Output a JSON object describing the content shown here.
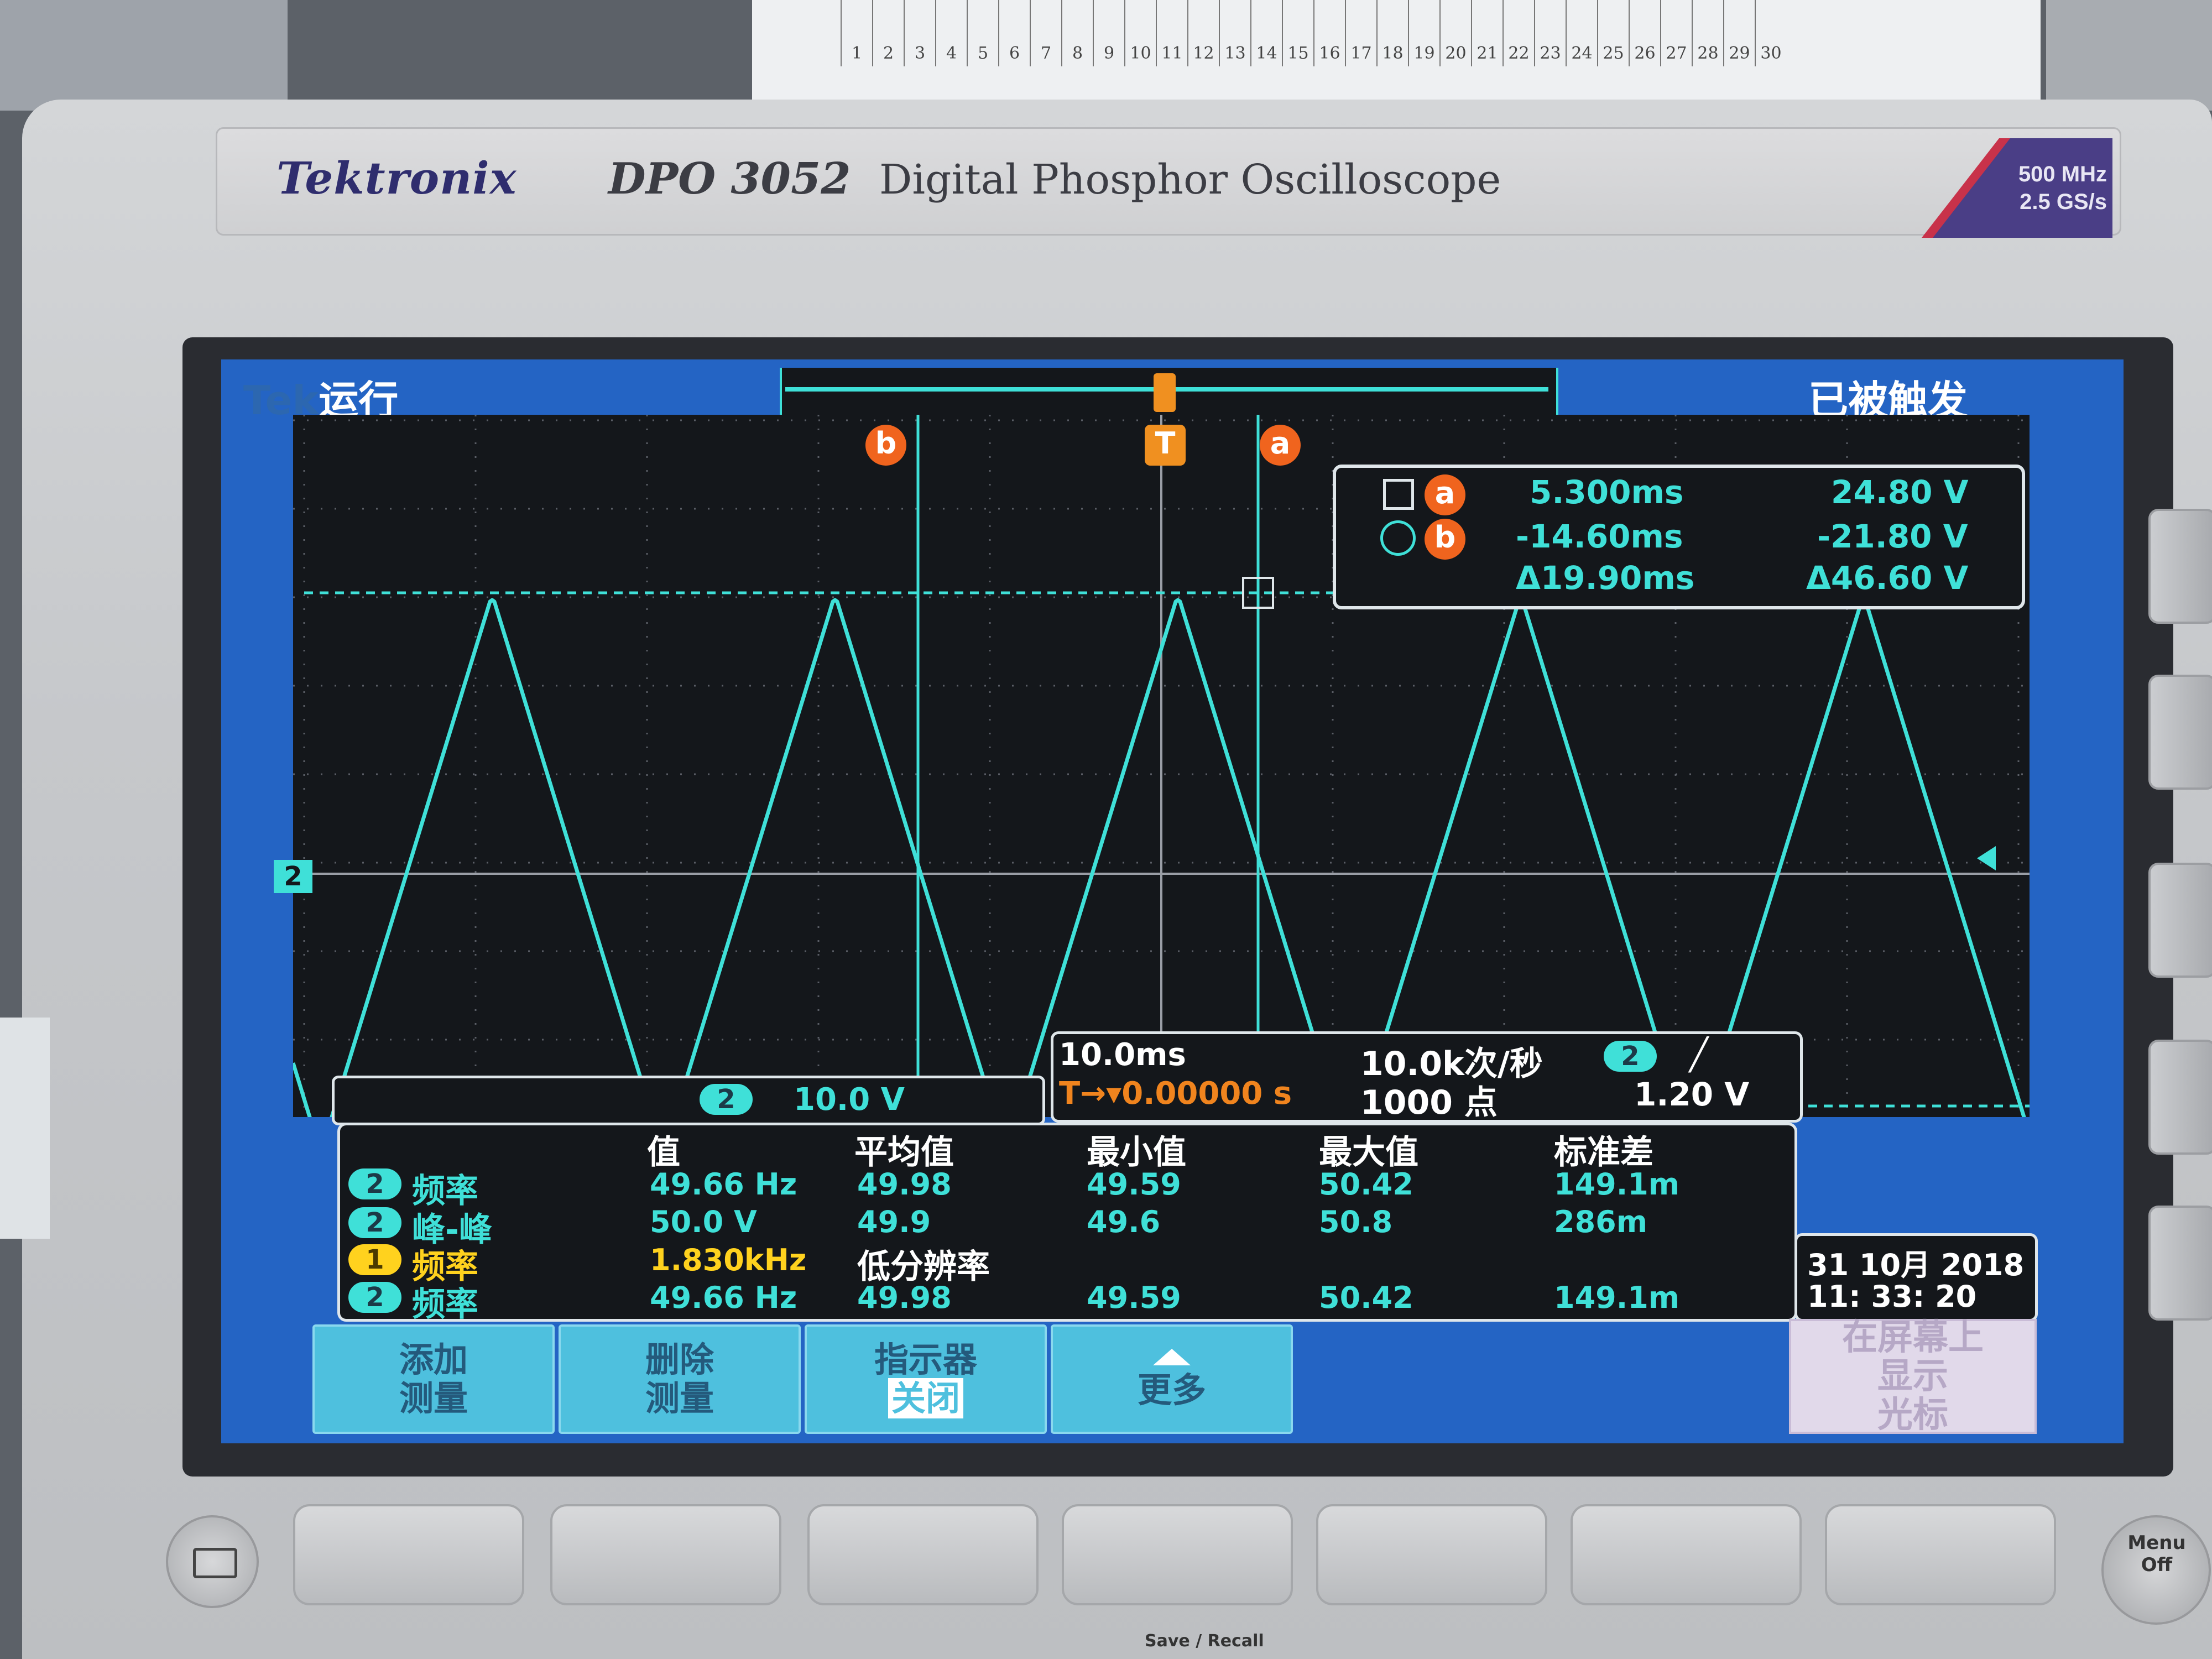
{
  "paper": {
    "numbers": [
      "1",
      "2",
      "3",
      "4",
      "5",
      "6",
      "7",
      "8",
      "9",
      "10",
      "11",
      "12",
      "13",
      "14",
      "15",
      "16",
      "17",
      "18",
      "19",
      "20",
      "21",
      "22",
      "23",
      "24",
      "25",
      "26",
      "27",
      "28",
      "29",
      "30"
    ]
  },
  "instrument": {
    "brand": "Tektronix",
    "model": "DPO 3052",
    "description": "Digital Phosphor Oscilloscope",
    "bandwidth": "500 MHz",
    "sample_rate": "2.5 GS/s"
  },
  "status": {
    "logo": "Tek",
    "run_state": "运行",
    "trigger_state": "已被触发"
  },
  "markers": {
    "cursor_b": "b",
    "trigger": "T",
    "cursor_a": "a",
    "channel_ref": "2"
  },
  "cursor_readout": {
    "a_label": "a",
    "b_label": "b",
    "a_time": "5.300ms",
    "a_volt": "24.80 V",
    "b_time": "-14.60ms",
    "b_volt": "-21.80 V",
    "delta_time": "Δ19.90ms",
    "delta_volt": "Δ46.60 V"
  },
  "channel_scale": {
    "channel": "2",
    "value": "10.0 V"
  },
  "horizontal": {
    "time_per_div": "10.0ms",
    "trigger_pos": "T→▾0.00000 s",
    "acq_rate": "10.0k次/秒",
    "record_length": "1000 点",
    "trigger_channel": "2",
    "trigger_slope": "╱",
    "trigger_level": "1.20 V"
  },
  "measurements": {
    "headers": [
      "值",
      "平均值",
      "最小值",
      "最大值",
      "标准差"
    ],
    "rows": [
      {
        "ch": "2",
        "name": "频率",
        "value": "49.66 Hz",
        "mean": "49.98",
        "min": "49.59",
        "max": "50.42",
        "std": "149.1m"
      },
      {
        "ch": "2",
        "name": "峰-峰",
        "value": "50.0 V",
        "mean": "49.9",
        "min": "49.6",
        "max": "50.8",
        "std": "286m"
      },
      {
        "ch": "1",
        "name": "频率",
        "value": "1.830kHz",
        "mean": "低分辨率",
        "min": "",
        "max": "",
        "std": ""
      },
      {
        "ch": "2",
        "name": "频率",
        "value": "49.66 Hz",
        "mean": "49.98",
        "min": "49.59",
        "max": "50.42",
        "std": "149.1m"
      }
    ]
  },
  "datetime": {
    "date": "31 10月 2018",
    "time": "11: 33: 20"
  },
  "menu": {
    "add_line1": "添加",
    "add_line2": "测量",
    "remove_line1": "删除",
    "remove_line2": "测量",
    "indicator_line1": "指示器",
    "indicator_line2": "关闭",
    "more": "更多",
    "side_line1": "在屏幕上",
    "side_line2": "显示",
    "side_line3": "光标"
  },
  "front_panel": {
    "save_recall": "Save / Recall",
    "menu": "Menu",
    "off": "Off"
  },
  "waveform": {
    "channel": "2",
    "frequency_hz": 49.66,
    "peak_to_peak_v": 50.0,
    "shape": "triangle",
    "color": "#3fe0d8"
  },
  "colors": {
    "ch2": "#3fe0d8",
    "ch1": "#ffd21e",
    "cursor_badge": "#f0641e",
    "screen_frame": "#2464c4",
    "softkey": "#4ec0de"
  }
}
